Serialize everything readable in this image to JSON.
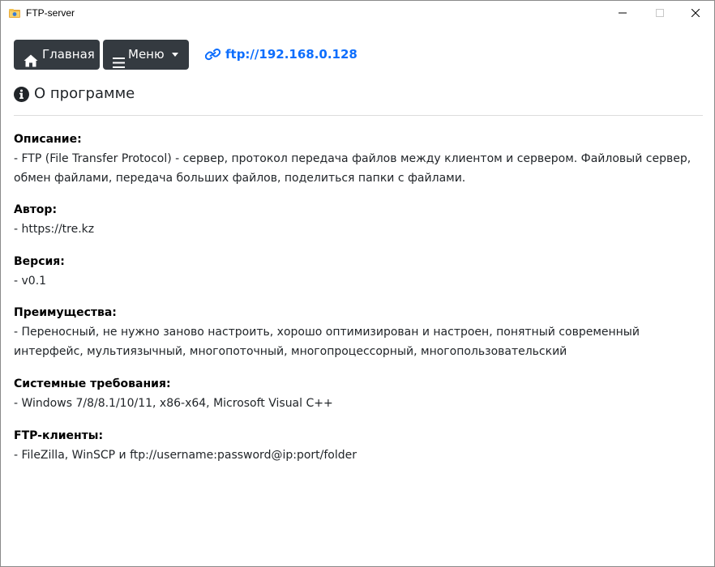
{
  "window": {
    "title": "FTP-server"
  },
  "toolbar": {
    "home_label": "Главная",
    "menu_label": "Меню",
    "server_url": "ftp://192.168.0.128"
  },
  "section": {
    "title": "О программе"
  },
  "info": [
    {
      "label": "Описание:",
      "value": "- FTP (File Transfer Protocol) - сервер, протокол передача файлов между клиентом и сервером. Файловый сервер, обмен файлами, передача больших файлов, поделиться папки с файлами."
    },
    {
      "label": "Автор:",
      "value": "- https://tre.kz"
    },
    {
      "label": "Версия:",
      "value": "- v0.1"
    },
    {
      "label": "Преимущества:",
      "value": "- Переносный, не нужно заново настроить, хорошо оптимизирован и настроен, понятный современный интерфейс, мультиязычный, многопоточный, многопроцессорный, многопользовательский"
    },
    {
      "label": "Системные требования:",
      "value": "- Windows 7/8/8.1/10/11, x86-x64, Microsoft Visual C++"
    },
    {
      "label": "FTP-клиенты:",
      "value": "- FileZilla, WinSCP и ftp://username:password@ip:port/folder"
    }
  ],
  "colors": {
    "button_bg": "#343a40",
    "link": "#0d6efd",
    "text": "#212529"
  },
  "icons": [
    "app-icon",
    "home-icon",
    "hamburger-menu-icon",
    "chevron-down-icon",
    "link-icon",
    "info-circle-icon",
    "minimize-icon",
    "maximize-icon",
    "close-icon"
  ]
}
